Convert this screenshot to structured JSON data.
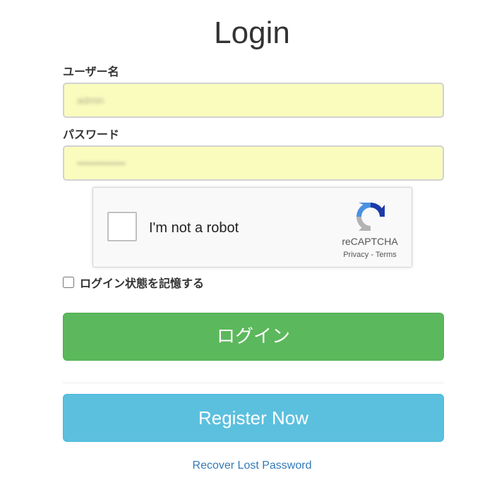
{
  "page": {
    "title": "Login"
  },
  "form": {
    "username_label": "ユーザー名",
    "username_value": "admin",
    "password_label": "パスワード",
    "password_value": "••••••••••••••",
    "remember_label": "ログイン状態を記憶する",
    "remember_checked": false,
    "login_button": "ログイン",
    "register_button": "Register Now",
    "recover_link": "Recover Lost Password"
  },
  "recaptcha": {
    "checkbox_text": "I'm not a robot",
    "brand": "reCAPTCHA",
    "privacy": "Privacy",
    "separator": " - ",
    "terms": "Terms",
    "icon": "recaptcha-logo-icon"
  },
  "colors": {
    "login_button": "#5cb85c",
    "register_button": "#5bc0de",
    "input_autofill_bg": "#fafcbe",
    "link": "#337ab7"
  }
}
